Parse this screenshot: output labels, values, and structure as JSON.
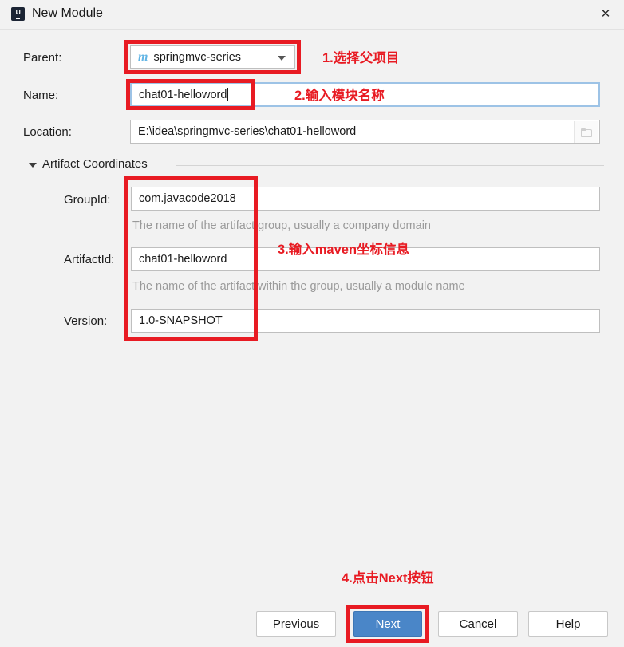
{
  "window": {
    "title": "New Module",
    "app_icon": "intellij-idea-icon",
    "close_label": "✕"
  },
  "form": {
    "parent": {
      "label": "Parent:",
      "value": "springmvc-series",
      "icon": "maven-module-icon",
      "icon_letter": "m",
      "dropdown_icon": "chevron-down-icon"
    },
    "name": {
      "label": "Name:",
      "value": "chat01-helloword",
      "focused": true
    },
    "location": {
      "label": "Location:",
      "value": "E:\\idea\\springmvc-series\\chat01-helloword",
      "browse_icon": "folder-icon"
    }
  },
  "artifact_coordinates": {
    "title": "Artifact Coordinates",
    "expanded": true,
    "collapse_icon": "triangle-down-icon",
    "group_id": {
      "label": "GroupId:",
      "value": "com.javacode2018",
      "hint": "The name of the artifact group, usually a company domain"
    },
    "artifact_id": {
      "label": "ArtifactId:",
      "value": "chat01-helloword",
      "hint": "The name of the artifact within the group, usually a module name"
    },
    "version": {
      "label": "Version:",
      "value": "1.0-SNAPSHOT"
    }
  },
  "annotations": {
    "color": "#e81b23",
    "step1": "1.选择父项目",
    "step2": "2.输入模块名称",
    "step3": "3.输入maven坐标信息",
    "step4": "4.点击Next按钮"
  },
  "buttons": {
    "previous": {
      "label": "Previous",
      "mnemonic": "P",
      "rest": "revious"
    },
    "next": {
      "label": "Next",
      "mnemonic": "N",
      "rest": "ext",
      "primary": true,
      "accent": "#4a86c8"
    },
    "cancel": {
      "label": "Cancel"
    },
    "help": {
      "label": "Help"
    }
  }
}
